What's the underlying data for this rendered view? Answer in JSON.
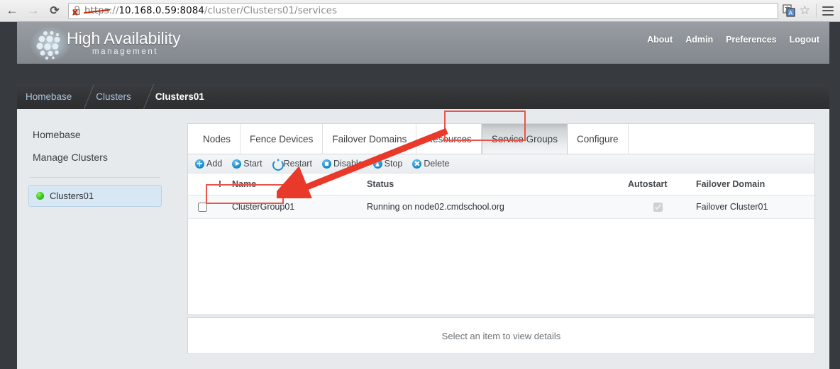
{
  "browser": {
    "back_icon": "back-arrow-icon",
    "forward_icon": "forward-arrow-icon",
    "reload_icon": "reload-icon",
    "url_scheme": "https",
    "url_separator": "://",
    "url_host": "10.168.0.59:8084",
    "url_path": "/cluster/Clusters01/services",
    "url_full": "https://10.168.0.59:8084/cluster/Clusters01/services",
    "lock_icon": "insecure-lock-icon",
    "translate_icon": "translate-icon",
    "bookmark_icon": "star-icon",
    "menu_icon": "hamburger-menu-icon"
  },
  "header": {
    "brand_title": "High Availability",
    "brand_subtitle": "management",
    "logo_icon": "cluster-dots-logo",
    "nav": [
      {
        "label": "About"
      },
      {
        "label": "Admin"
      },
      {
        "label": "Preferences"
      },
      {
        "label": "Logout"
      }
    ]
  },
  "breadcrumb": {
    "items": [
      {
        "label": "Homebase",
        "current": false
      },
      {
        "label": "Clusters",
        "current": false
      },
      {
        "label": "Clusters01",
        "current": true
      }
    ]
  },
  "sidebar": {
    "links": [
      {
        "label": "Homebase"
      },
      {
        "label": "Manage Clusters"
      }
    ],
    "cluster": {
      "label": "Clusters01",
      "status_icon": "green-status-dot",
      "status_color": "#36c417"
    }
  },
  "tabs": [
    {
      "label": "Nodes",
      "active": false
    },
    {
      "label": "Fence Devices",
      "active": false
    },
    {
      "label": "Failover Domains",
      "active": false
    },
    {
      "label": "Resources",
      "active": false
    },
    {
      "label": "Service Groups",
      "active": true
    },
    {
      "label": "Configure",
      "active": false
    }
  ],
  "toolbar": {
    "buttons": [
      {
        "label": "Add",
        "icon": "add-circle-icon"
      },
      {
        "label": "Start",
        "icon": "play-circle-icon"
      },
      {
        "label": "Restart",
        "icon": "restart-circle-icon"
      },
      {
        "label": "Disable",
        "icon": "stop-square-circle-icon"
      },
      {
        "label": "Stop",
        "icon": "triangle-up-circle-icon"
      },
      {
        "label": "Delete",
        "icon": "x-circle-icon"
      }
    ]
  },
  "table": {
    "headers": {
      "select": "",
      "alert": "!",
      "name": "Name",
      "status": "Status",
      "autostart": "Autostart",
      "failover_domain": "Failover Domain"
    },
    "rows": [
      {
        "selected": false,
        "alert": "",
        "name": "ClusterGroup01",
        "status": "Running on node02.cmdschool.org",
        "autostart": true,
        "failover_domain": "Failover Cluster01"
      }
    ]
  },
  "details": {
    "placeholder": "Select an item to view details"
  },
  "annotations": {
    "color": "#e8554a",
    "highlight_tab": "Service Groups",
    "highlight_row_name": "ClusterGroup01",
    "arrow": "red-arrow-pointing-to-clustergroup01"
  }
}
